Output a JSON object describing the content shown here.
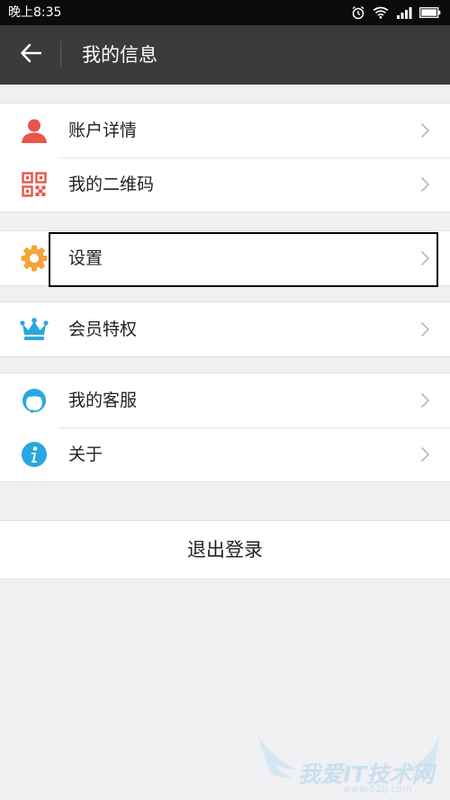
{
  "status": {
    "time": "晚上8:35"
  },
  "header": {
    "title": "我的信息"
  },
  "menu": {
    "groups": [
      {
        "items": [
          {
            "label": "账户详情"
          },
          {
            "label": "我的二维码"
          }
        ]
      },
      {
        "items": [
          {
            "label": "设置"
          }
        ]
      },
      {
        "items": [
          {
            "label": "会员特权"
          }
        ]
      },
      {
        "items": [
          {
            "label": "我的客服"
          },
          {
            "label": "关于"
          }
        ]
      }
    ]
  },
  "logout": {
    "label": "退出登录"
  },
  "watermark": {
    "text": "我爱IT技术网",
    "url": "www.52ij.com"
  },
  "colors": {
    "appbar": "#3b3b3b",
    "account": "#e8554a",
    "qr": "#e8554a",
    "settings": "#f5a33b",
    "vip": "#2aa6e0",
    "service": "#2aa6e0",
    "about": "#2aa6e0"
  }
}
